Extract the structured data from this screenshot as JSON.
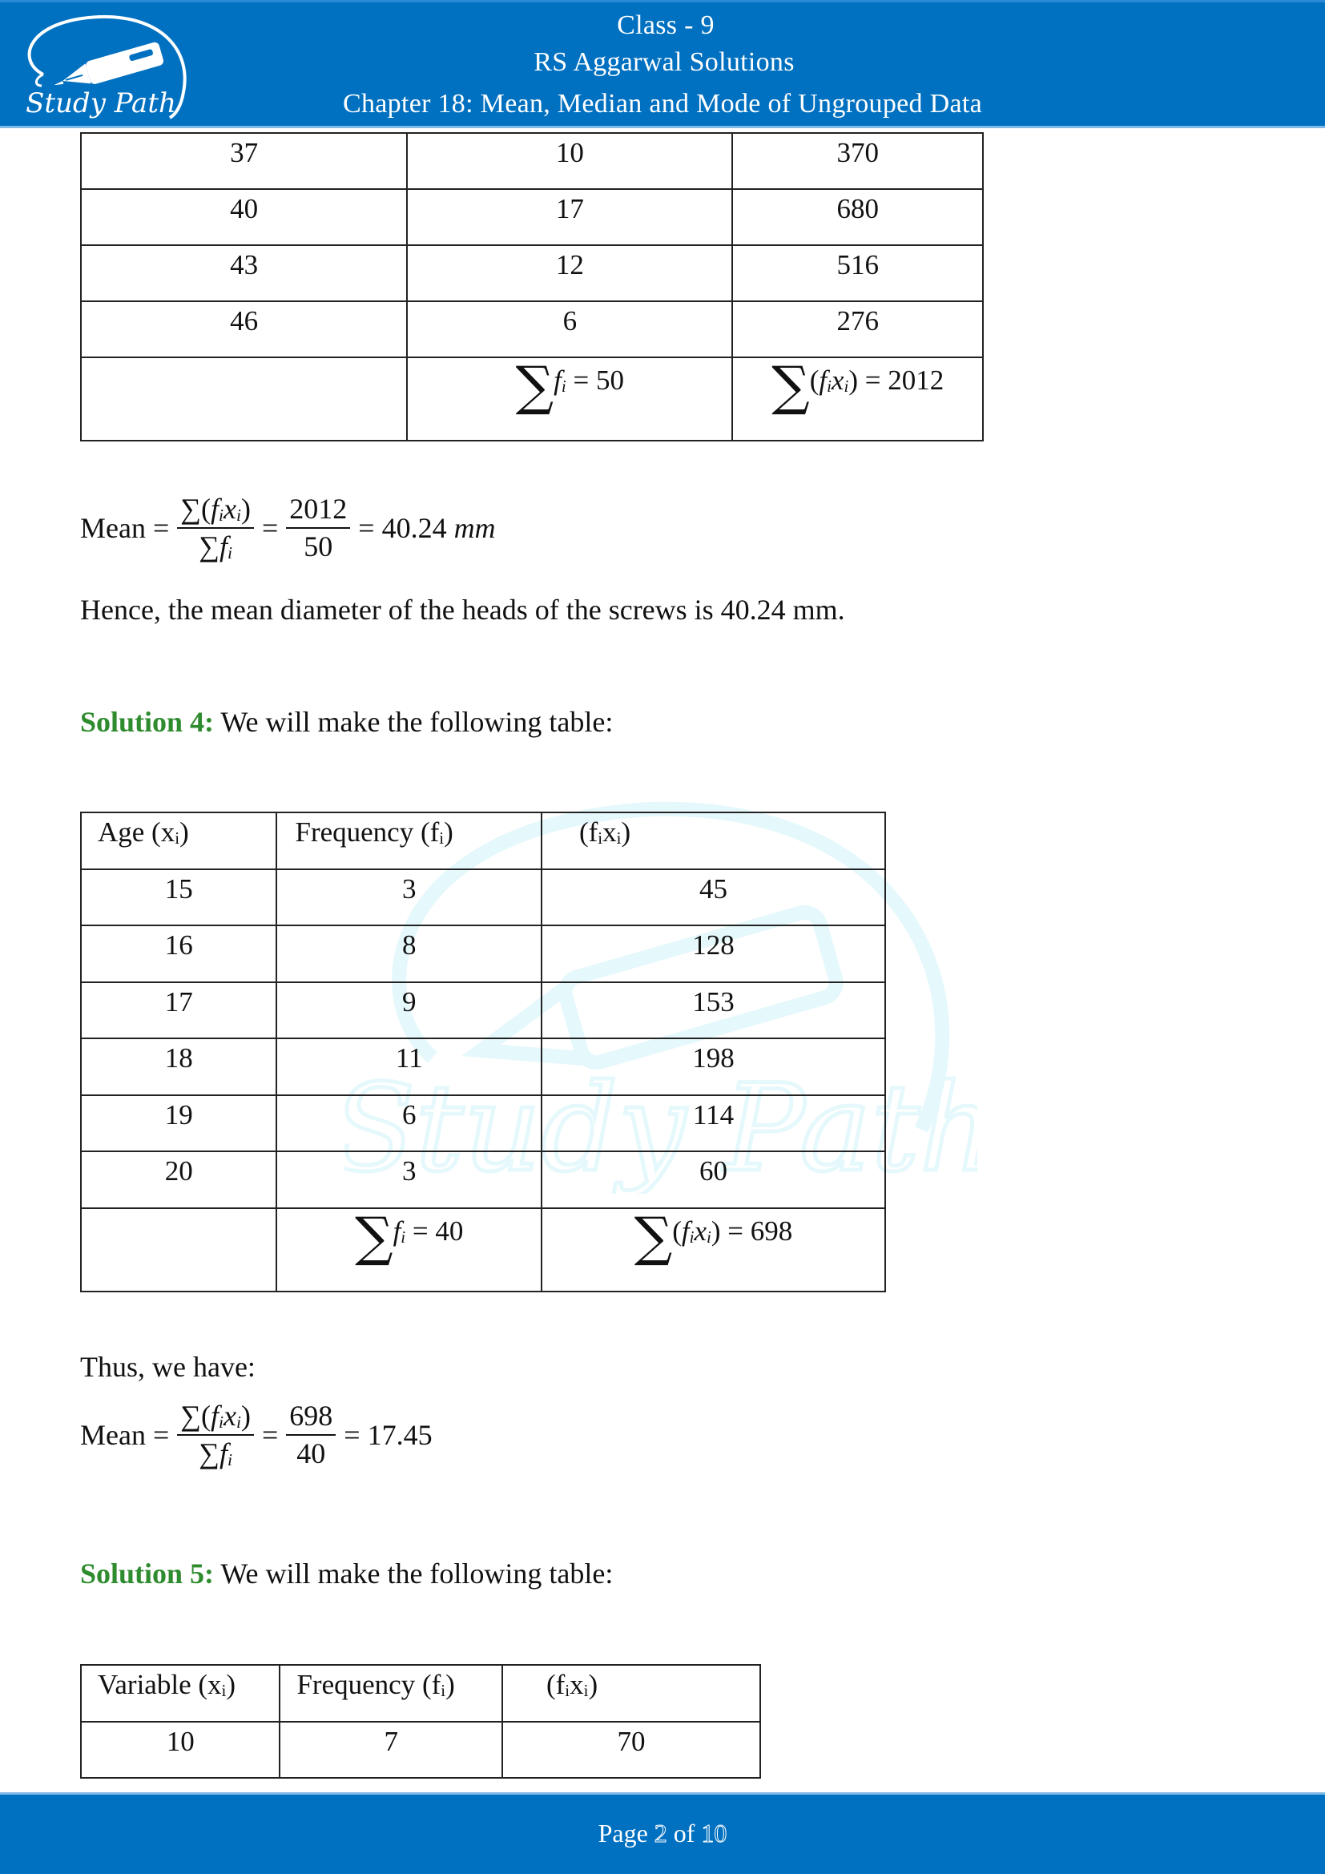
{
  "header": {
    "logo_text": "Study Path",
    "class_line": "Class - 9",
    "book_line": "RS Aggarwal Solutions",
    "chapter_line": "Chapter 18: Mean, Median and Mode of Ungrouped Data"
  },
  "table_continued": {
    "rows": [
      [
        "37",
        "10",
        "370"
      ],
      [
        "40",
        "17",
        "680"
      ],
      [
        "43",
        "12",
        "516"
      ],
      [
        "46",
        "6",
        "276"
      ]
    ],
    "sum_f": "50",
    "sum_fx": "2012"
  },
  "mean_3": {
    "label": "Mean",
    "numerator_value": "2012",
    "denominator_value": "50",
    "result": "40.24",
    "unit": "mm",
    "conclusion": "Hence, the mean diameter of the heads of the screws is 40.24 mm."
  },
  "solution4": {
    "label": "Solution 4:",
    "intro": "We will make the following table:",
    "headers": [
      "Age (x",
      "Frequency (f",
      "(f"
    ],
    "rows": [
      [
        "15",
        "3",
        "45"
      ],
      [
        "16",
        "8",
        "128"
      ],
      [
        "17",
        "9",
        "153"
      ],
      [
        "18",
        "11",
        "198"
      ],
      [
        "19",
        "6",
        "114"
      ],
      [
        "20",
        "3",
        "60"
      ]
    ],
    "sum_f": "40",
    "sum_fx": "698",
    "thus": "Thus, we have:",
    "mean_label": "Mean",
    "numerator_value": "698",
    "denominator_value": "40",
    "result": "17.45"
  },
  "solution5": {
    "label": "Solution 5:",
    "intro": "We will make the following table:",
    "headers": [
      "Variable (x",
      "Frequency (f",
      "(f"
    ],
    "rows": [
      [
        "10",
        "7",
        "70"
      ]
    ]
  },
  "footer": {
    "page_prefix": "Page ",
    "page_current": "2",
    "page_of": " of ",
    "page_total": "10"
  },
  "colors": {
    "brand_blue": "#0070C0",
    "solution_green": "#2e8b2e",
    "watermark_cyan": "#dff8fb"
  }
}
